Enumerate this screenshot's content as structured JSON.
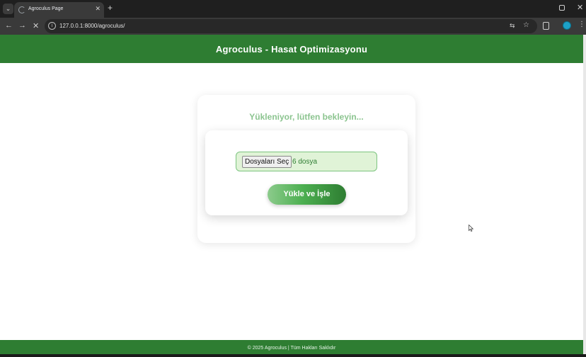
{
  "browser": {
    "tab_title": "Agroculus Page",
    "new_tab_label": "+",
    "url": "127.0.0.1:8000/agroculus/",
    "nav": {
      "back": "←",
      "forward": "→",
      "stop": "✕"
    }
  },
  "page": {
    "header_title": "Agroculus - Hasat Optimizasyonu",
    "loading_text": "Yükleniyor, lütfen bekleyin...",
    "file_input": {
      "button_label": "Dosyaları Seç",
      "status": "6 dosya"
    },
    "upload_button": "Yükle ve İşle",
    "footer": "© 2025 Agroculus | Tüm Hakları Saklıdır"
  },
  "colors": {
    "brand_green": "#2e7d32",
    "loading_text": "#8bc48f",
    "file_box_bg": "#e0f3d7",
    "profile": "#1da1c7"
  },
  "icons": [
    "tab-search-icon",
    "loading-spinner-icon",
    "close-icon",
    "back-icon",
    "forward-icon",
    "stop-icon",
    "site-info-icon",
    "translate-icon",
    "bookmark-star-icon",
    "extensions-icon",
    "profile-avatar",
    "menu-dots-icon",
    "restore-icon",
    "mouse-cursor-icon"
  ]
}
